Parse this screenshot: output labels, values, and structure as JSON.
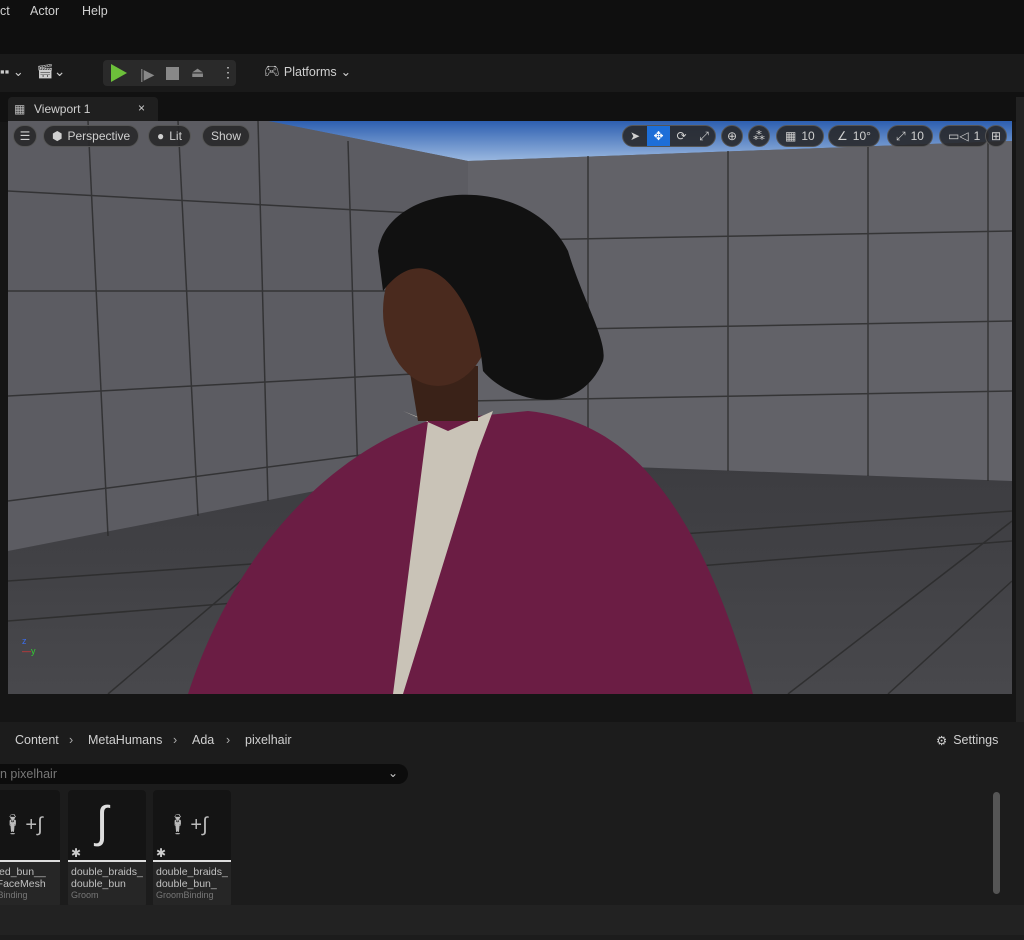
{
  "menu": [
    "ct",
    "Actor",
    "Help"
  ],
  "toolbar": {
    "platforms_label": "Platforms",
    "play_color": "#6cc03a"
  },
  "viewport_tab": {
    "label": "Viewport 1"
  },
  "viewport": {
    "perspective": "Perspective",
    "lit": "Lit",
    "show": "Show",
    "grid_snap": "10",
    "rotation_snap": "10°",
    "scale_snap": "10",
    "camera_speed": "1",
    "active_tool": "translate",
    "active_color": "#1d6ed8"
  },
  "breadcrumb": [
    "Content",
    "MetaHumans",
    "Ada",
    "pixelhair"
  ],
  "settings_label": "Settings",
  "search": {
    "placeholder": "n pixelhair"
  },
  "assets": [
    {
      "name": "aided_bun__\na_FaceMesh",
      "type": "omBinding",
      "icon": "groom-binding-icon"
    },
    {
      "name": "double_braids_\ndouble_bun",
      "type": "Groom",
      "icon": "groom-icon"
    },
    {
      "name": "double_braids_\ndouble_bun_",
      "type": "GroomBinding",
      "icon": "groom-binding-icon"
    }
  ]
}
